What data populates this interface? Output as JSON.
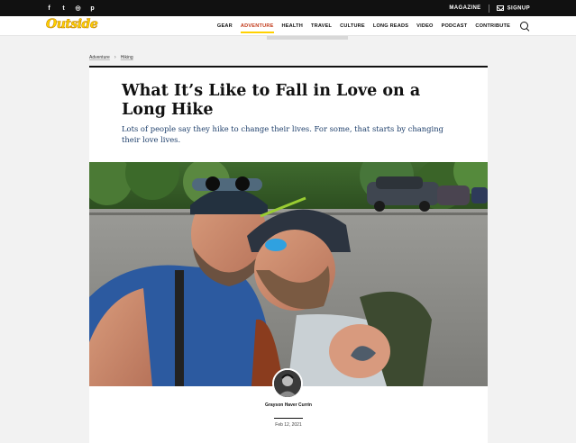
{
  "topbar": {
    "social_icons": [
      "facebook-icon",
      "twitter-icon",
      "instagram-icon",
      "pinterest-icon"
    ],
    "social_glyphs": [
      "f",
      "t",
      "◎",
      "p"
    ],
    "magazine_label": "MAGAZINE",
    "signup_label": "SIGNUP"
  },
  "header": {
    "logo_text": "Outside",
    "nav": [
      "GEAR",
      "ADVENTURE",
      "HEALTH",
      "TRAVEL",
      "CULTURE",
      "LONG READS",
      "VIDEO",
      "PODCAST",
      "CONTRIBUTE"
    ],
    "active_nav": "ADVENTURE",
    "accent_color": "#ffd100",
    "active_color": "#c23a1a"
  },
  "breadcrumb": [
    "Adventure",
    "Hiking"
  ],
  "article": {
    "title": "What It’s Like to Fall in Love on a Long Hike",
    "dek": "Lots of people say they hike to change their lives. For some, that starts by changing their love lives.",
    "hero_alt": "selfie of two hikers in a parking lot",
    "author": "Grayson Haver Currin",
    "date": "Feb 12, 2021"
  }
}
